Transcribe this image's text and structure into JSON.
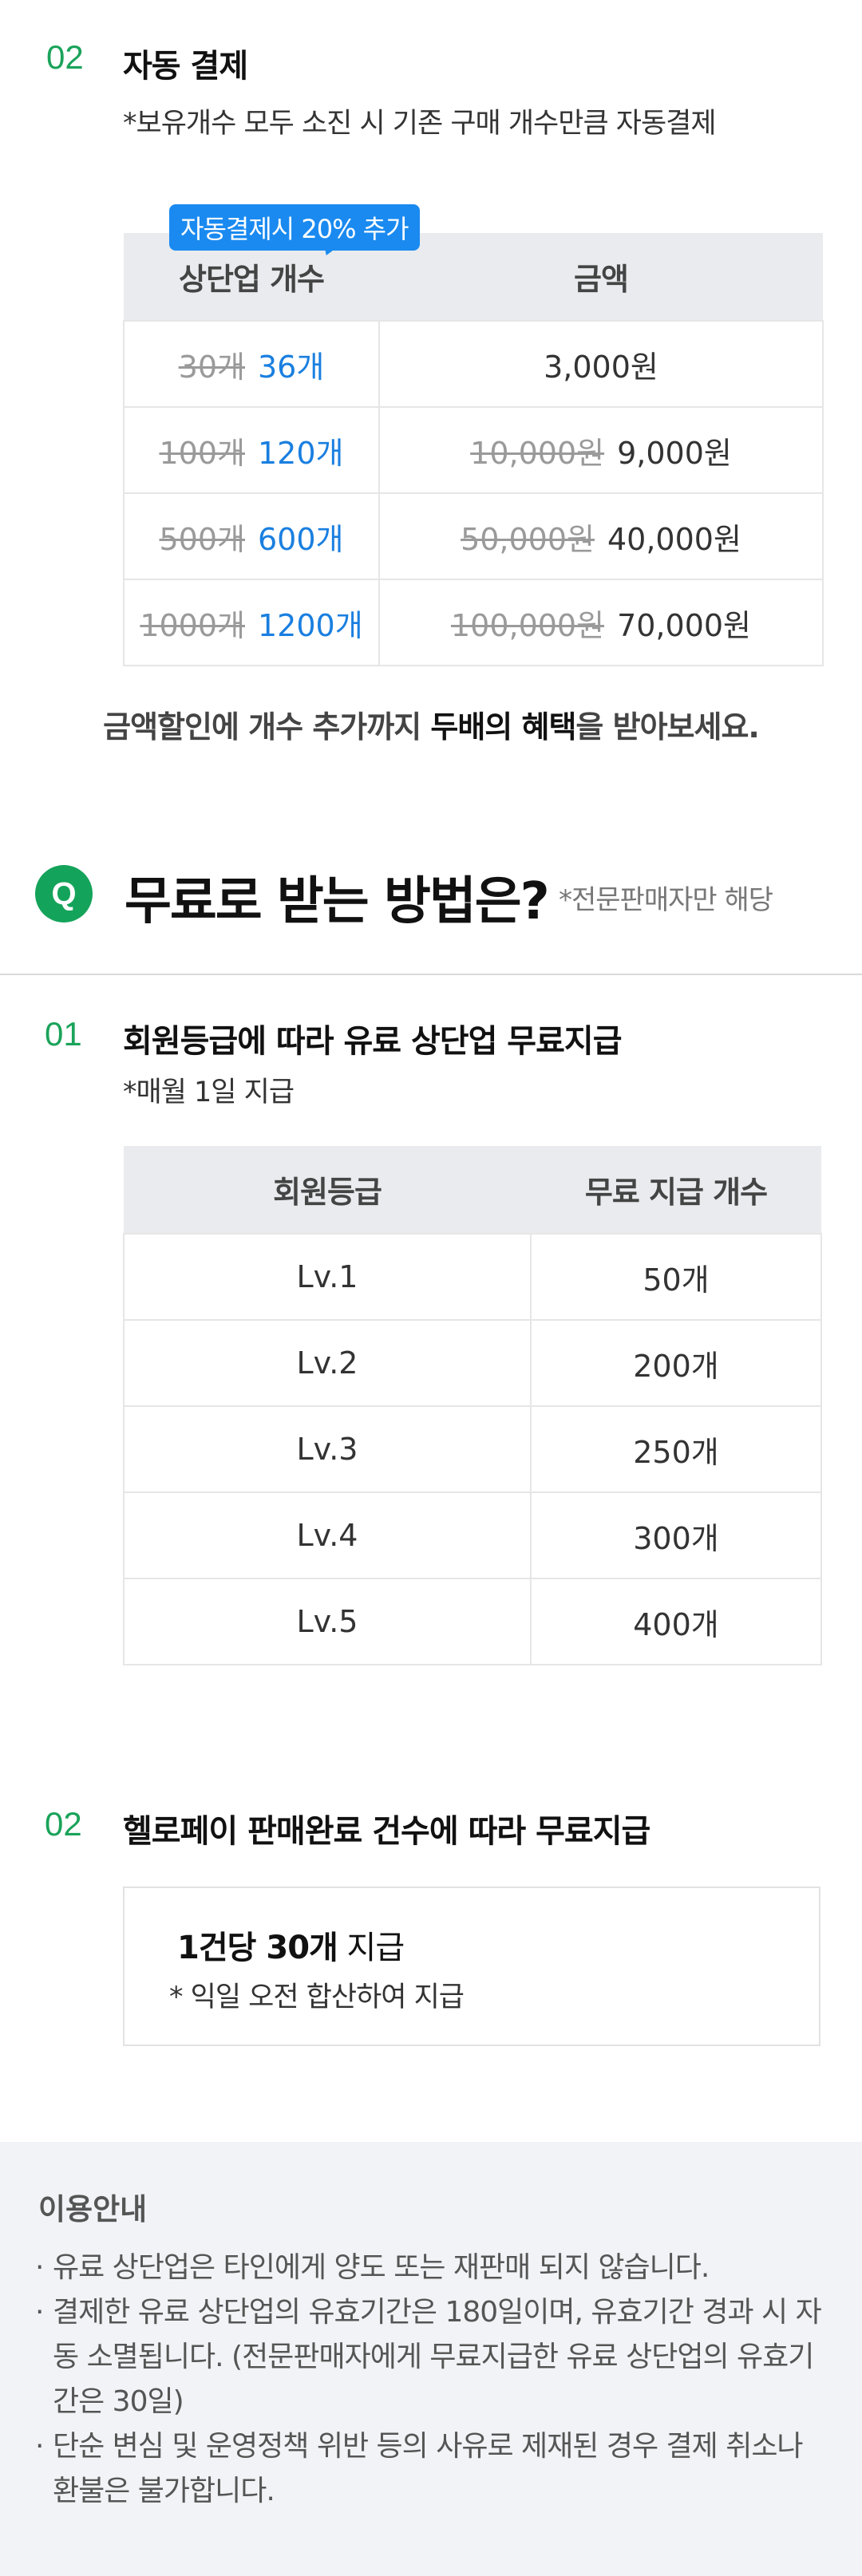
{
  "auto_pay": {
    "num": "02",
    "title": "자동 결제",
    "note": "*보유개수 모두 소진 시 기존 구매 개수만큼 자동결제",
    "badge": "자동결제시 20% 추가",
    "headers": [
      "상단업 개수",
      "금액"
    ],
    "rows": [
      {
        "count_old": "30개",
        "count_new": "36개",
        "price_old": "",
        "price": "3,000원"
      },
      {
        "count_old": "100개",
        "count_new": "120개",
        "price_old": "10,000원",
        "price": "9,000원"
      },
      {
        "count_old": "500개",
        "count_new": "600개",
        "price_old": "50,000원",
        "price": "40,000원"
      },
      {
        "count_old": "1000개",
        "count_new": "1200개",
        "price_old": "100,000원",
        "price": "70,000원"
      }
    ],
    "benefit_prefix": "금액할인에 개수 추가까지 ",
    "benefit_strong": "두배의 혜택",
    "benefit_suffix": "을 받아보세요."
  },
  "free": {
    "q_icon": "Q",
    "title": "무료로 받는 방법은?",
    "note": "*전문판매자만 해당"
  },
  "grade_section": {
    "num": "01",
    "title": "회원등급에 따라 유료 상단업 무료지급",
    "note": "*매월 1일 지급",
    "headers": [
      "회원등급",
      "무료 지급 개수"
    ],
    "rows": [
      {
        "grade": "Lv.1",
        "count": "50개"
      },
      {
        "grade": "Lv.2",
        "count": "200개"
      },
      {
        "grade": "Lv.3",
        "count": "250개"
      },
      {
        "grade": "Lv.4",
        "count": "300개"
      },
      {
        "grade": "Lv.5",
        "count": "400개"
      }
    ]
  },
  "hellopay_section": {
    "num": "02",
    "title": "헬로페이 판매완료 건수에 따라 무료지급",
    "box_strong": "1건당 30개",
    "box_suffix": " 지급",
    "box_note": "* 익일 오전 합산하여 지급"
  },
  "notice": {
    "title": "이용안내",
    "items": [
      "유료 상단업은 타인에게 양도 또는 재판매 되지 않습니다.",
      "결제한 유료 상단업의 유효기간은 180일이며, 유효기간 경과 시 자동 소멸됩니다. (전문판매자에게 무료지급한 유료 상단업의 유효기간은 30일)",
      "단순 변심 및 운영정책 위반 등의 사유로 제재된 경우 결제 취소나 환불은 불가합니다."
    ]
  },
  "colors": {
    "accent_green": "#1aa35a",
    "accent_blue": "#1a7fe0",
    "badge_blue": "#1a8af0"
  }
}
